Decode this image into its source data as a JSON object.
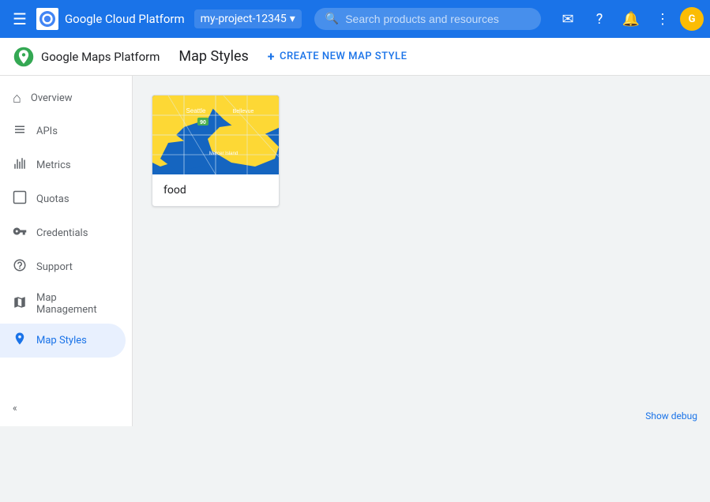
{
  "topbar": {
    "menu_icon": "☰",
    "brand_name": "Google Cloud Platform",
    "project_name": "my-project-12345",
    "search_placeholder": "Search products and resources",
    "search_expand_icon": "▾",
    "icons": [
      "email",
      "help",
      "notifications",
      "more"
    ],
    "avatar_letter": "G"
  },
  "subheader": {
    "brand_name": "Google Maps Platform",
    "page_title": "Map Styles",
    "create_btn_label": "CREATE NEW MAP STYLE",
    "create_icon": "+"
  },
  "sidebar": {
    "items": [
      {
        "id": "overview",
        "label": "Overview",
        "icon": "⌂",
        "active": false
      },
      {
        "id": "apis",
        "label": "APIs",
        "icon": "☰",
        "active": false
      },
      {
        "id": "metrics",
        "label": "Metrics",
        "icon": "▦",
        "active": false
      },
      {
        "id": "quotas",
        "label": "Quotas",
        "icon": "⬜",
        "active": false
      },
      {
        "id": "credentials",
        "label": "Credentials",
        "icon": "🔑",
        "active": false
      },
      {
        "id": "support",
        "label": "Support",
        "icon": "👤",
        "active": false
      },
      {
        "id": "map-management",
        "label": "Map Management",
        "icon": "▦",
        "active": false
      },
      {
        "id": "map-styles",
        "label": "Map Styles",
        "icon": "◎",
        "active": true
      }
    ],
    "collapse_label": "«"
  },
  "map_styles": {
    "cards": [
      {
        "id": "food",
        "label": "food",
        "preview_type": "seattle-blue-yellow"
      }
    ]
  },
  "bottombar": {
    "debug_label": "Show debug"
  }
}
